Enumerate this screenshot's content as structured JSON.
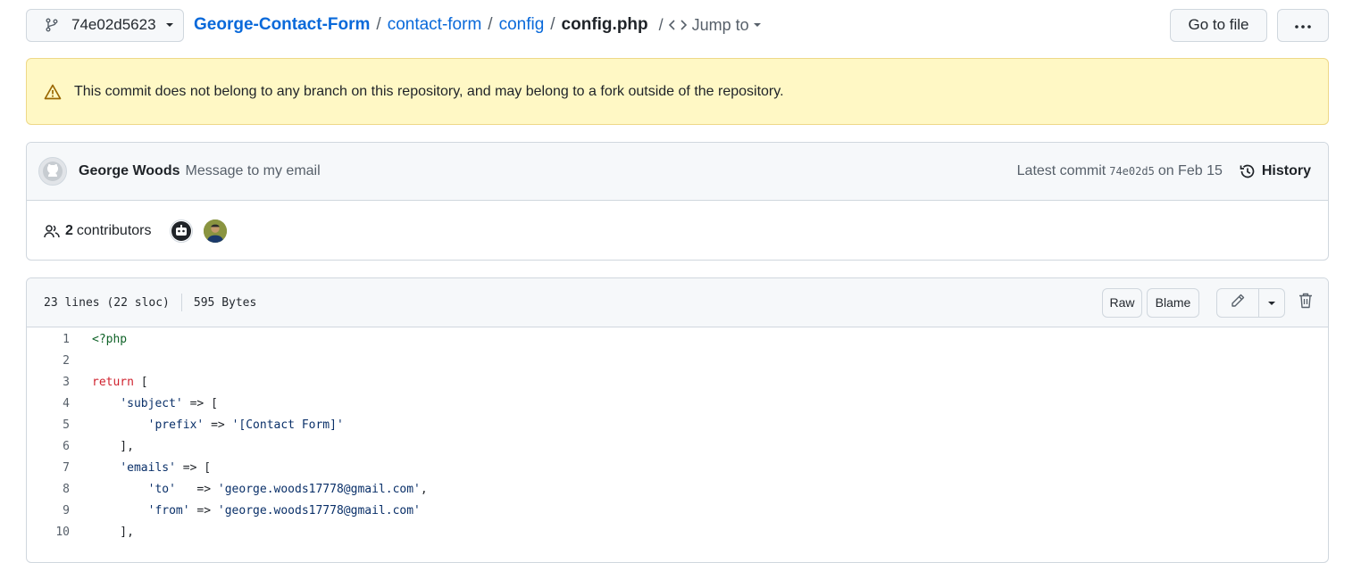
{
  "branch": {
    "label": "74e02d5623"
  },
  "breadcrumb": {
    "repo": "George-Contact-Form",
    "dirs": [
      "contact-form",
      "config"
    ],
    "file": "config.php",
    "separator": "/"
  },
  "jump_to": {
    "label": "Jump to"
  },
  "actions": {
    "go_to_file": "Go to file"
  },
  "flash": {
    "message": "This commit does not belong to any branch on this repository, and may belong to a fork outside of the repository."
  },
  "commit": {
    "author": "George Woods",
    "message": "Message to my email",
    "latest_prefix": "Latest commit",
    "sha": "74e02d5",
    "date": "on Feb 15",
    "history_label": "History"
  },
  "contributors": {
    "count": "2",
    "label": "contributors"
  },
  "file": {
    "lines_info": "23 lines (22 sloc)",
    "size": "595 Bytes",
    "raw_label": "Raw",
    "blame_label": "Blame"
  },
  "code_lines": [
    {
      "n": "1",
      "text": "<?php"
    },
    {
      "n": "2",
      "text": ""
    },
    {
      "n": "3",
      "text": "return ["
    },
    {
      "n": "4",
      "text": "    'subject' => ["
    },
    {
      "n": "5",
      "text": "        'prefix' => '[Contact Form]'"
    },
    {
      "n": "6",
      "text": "    ],"
    },
    {
      "n": "7",
      "text": "    'emails' => ["
    },
    {
      "n": "8",
      "text": "        'to'   => 'george.woods17778@gmail.com',"
    },
    {
      "n": "9",
      "text": "        'from' => 'george.woods17778@gmail.com'"
    },
    {
      "n": "10",
      "text": "    ],"
    }
  ],
  "colors": {
    "link": "#0969da",
    "flash_bg": "#fff8c5",
    "keyword": "#cf222e",
    "string": "#0a3069",
    "tag": "#116329"
  }
}
